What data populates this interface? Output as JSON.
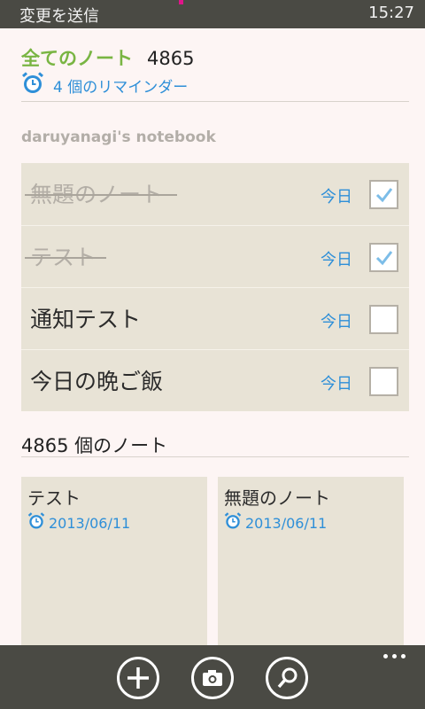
{
  "status_bar": {
    "left_text": "変更を送信",
    "time": "15:27"
  },
  "header": {
    "title": "全てのノート",
    "count": "4865",
    "reminder_link": "4 個のリマインダー"
  },
  "notebook": {
    "name": "daruyanagi's notebook"
  },
  "reminders": [
    {
      "title": "無題のノート",
      "date": "今日",
      "done": true
    },
    {
      "title": "テスト",
      "date": "今日",
      "done": true
    },
    {
      "title": "通知テスト",
      "date": "今日",
      "done": false
    },
    {
      "title": "今日の晩ご飯",
      "date": "今日",
      "done": false
    }
  ],
  "notes_section": {
    "label": "4865 個のノート"
  },
  "notes": [
    {
      "title": "テスト",
      "date": "2013/06/11"
    },
    {
      "title": "無題のノート",
      "date": "2013/06/11"
    }
  ],
  "app_bar": {
    "buttons": [
      {
        "icon": "add-icon"
      },
      {
        "icon": "camera-icon"
      },
      {
        "icon": "search-icon"
      }
    ],
    "more_icon": "more-icon"
  },
  "colors": {
    "accent_green": "#79b543",
    "accent_blue": "#2e8fd8",
    "chrome": "#4a4a44",
    "tile": "#e8e3d6",
    "background": "#fdf5f4"
  }
}
